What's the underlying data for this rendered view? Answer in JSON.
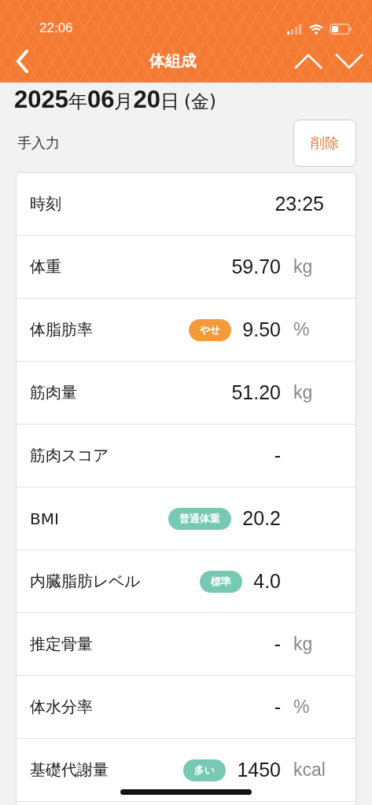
{
  "status_bar": {
    "time": "22:06"
  },
  "header": {
    "title": "体組成"
  },
  "date": {
    "year": "2025",
    "year_unit": "年",
    "month": "06",
    "month_unit": "月",
    "day": "20",
    "day_unit": "日",
    "weekday": "(金)"
  },
  "entry": {
    "source": "手入力",
    "delete_button": "削除"
  },
  "rows": [
    {
      "kind": "time",
      "label": "時刻",
      "value": "23:25"
    },
    {
      "kind": "measure",
      "label": "体重",
      "value": "59.70",
      "unit": "kg"
    },
    {
      "kind": "measure",
      "label": "体脂肪率",
      "value": "9.50",
      "unit": "%",
      "tag": {
        "text": "やせ",
        "color": "#f39a3c"
      }
    },
    {
      "kind": "measure",
      "label": "筋肉量",
      "value": "51.20",
      "unit": "kg"
    },
    {
      "kind": "measure",
      "label": "筋肉スコア",
      "value": "-"
    },
    {
      "kind": "measure",
      "label": "BMI",
      "value": "20.2",
      "tag": {
        "text": "普通体重",
        "color": "#78c9b4"
      }
    },
    {
      "kind": "measure",
      "label": "内臓脂肪レベル",
      "value": "4.0",
      "tag": {
        "text": "標準",
        "color": "#78c9b4"
      }
    },
    {
      "kind": "measure",
      "label": "推定骨量",
      "value": "-",
      "unit": "kg"
    },
    {
      "kind": "measure",
      "label": "体水分率",
      "value": "-",
      "unit": "%"
    },
    {
      "kind": "measure",
      "label": "基礎代謝量",
      "value": "1450",
      "unit": "kcal",
      "tag": {
        "text": "多い",
        "color": "#78c9b4"
      }
    }
  ]
}
